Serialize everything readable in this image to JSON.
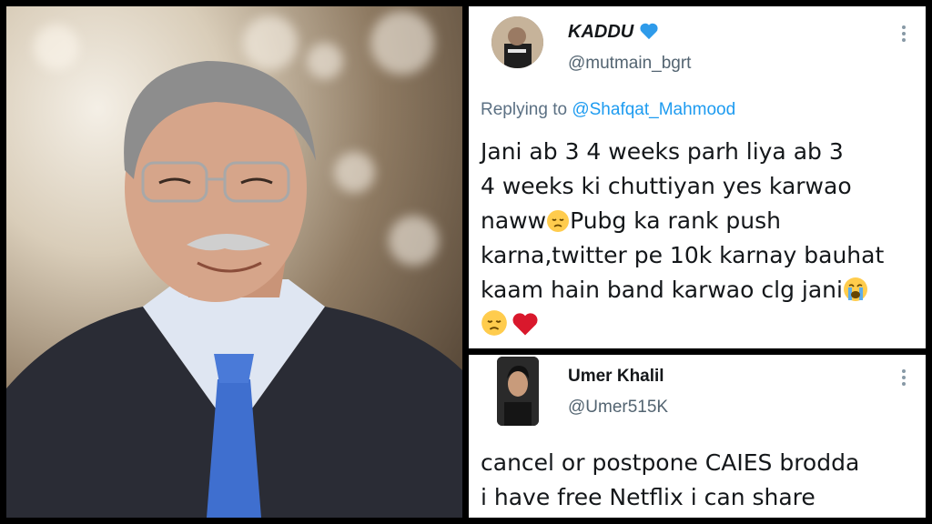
{
  "tweets": [
    {
      "name": "KADDU",
      "handle": "@mutmain_bgrt",
      "replying_prefix": "Replying to",
      "replying_to": "@Shafqat_Mahmood",
      "lines": [
        "Jani ab 3 4 weeks parh liya ab 3",
        "4 weeks ki chuttiyan yes karwao",
        "naww",
        "Pubg ka rank push",
        "karna,twitter pe 10k karnay bauhat",
        "kaam hain band karwao clg jani"
      ]
    },
    {
      "name": "Umer Khalil",
      "handle": "@Umer515K",
      "lines": [
        "cancel or postpone CAIES brodda",
        "i have free Netflix i can share"
      ]
    }
  ],
  "icons": {
    "verified_heart": "blue-heart-icon",
    "more": "more-options-icon",
    "pensive": "pensive-face-emoji",
    "crying": "loudly-crying-face-emoji",
    "heart": "red-heart-emoji"
  },
  "colors": {
    "mention": "#1d9bf0",
    "text": "#14171a",
    "muted": "#536471",
    "blue_heart": "#2f9bea",
    "red_heart": "#d9182c"
  }
}
